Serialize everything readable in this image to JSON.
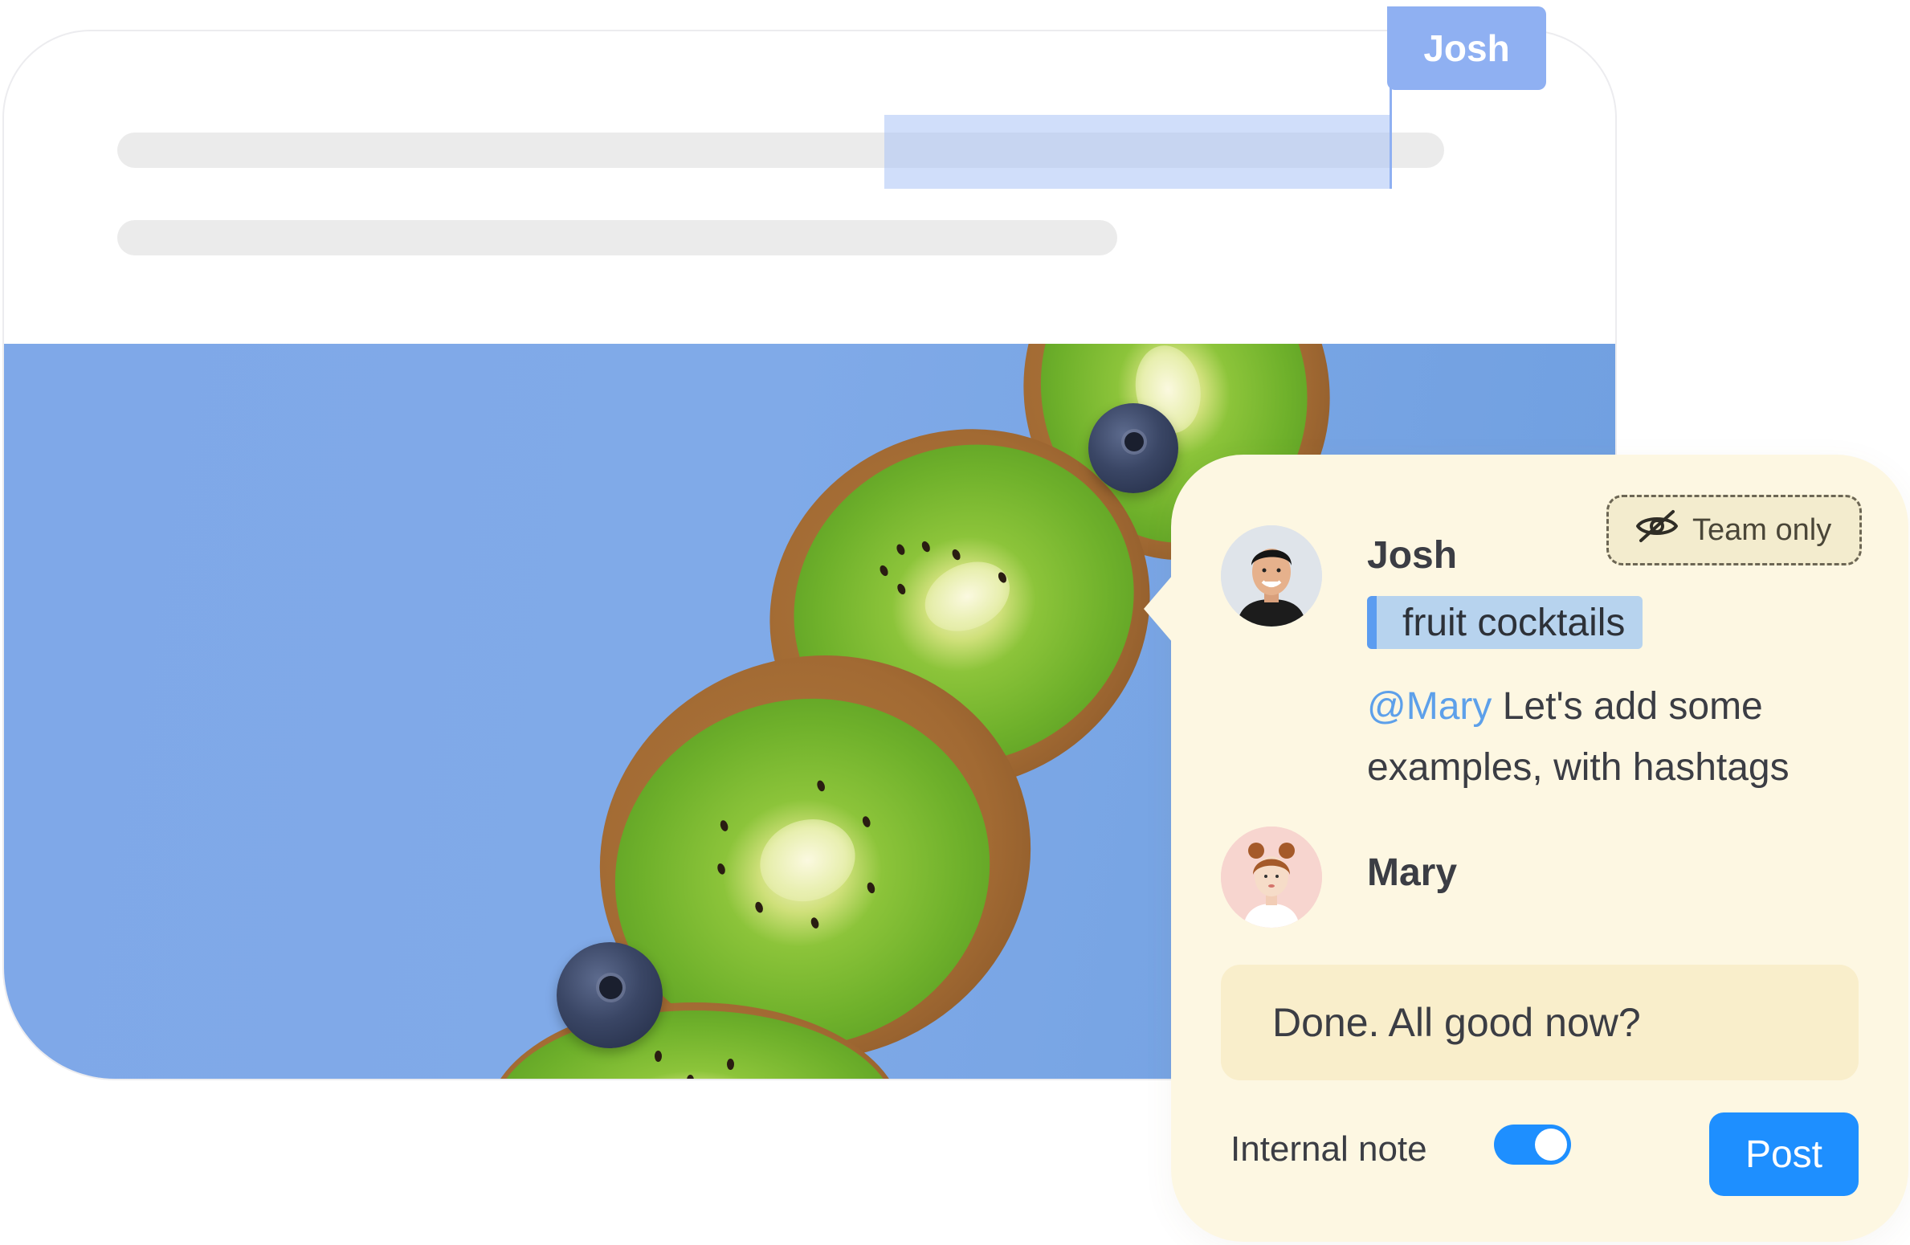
{
  "document": {
    "cursor_user": "Josh"
  },
  "comment": {
    "visibility_badge": "Team only",
    "visibility_icon": "eye-off-icon",
    "thread": [
      {
        "author": "Josh",
        "quoted_text": "fruit cocktails",
        "mention": "@Mary",
        "body": " Let's add some examples, with hashtags"
      },
      {
        "author": "Mary"
      }
    ],
    "reply_text": "Done. All good now?",
    "internal_note_label": "Internal note",
    "internal_note_enabled": true,
    "post_label": "Post"
  },
  "colors": {
    "accent_blue": "#1e8fff",
    "cursor_blue": "#8fb0f2",
    "panel_bg": "#fdf7e2",
    "mention_blue": "#5da0ea"
  }
}
